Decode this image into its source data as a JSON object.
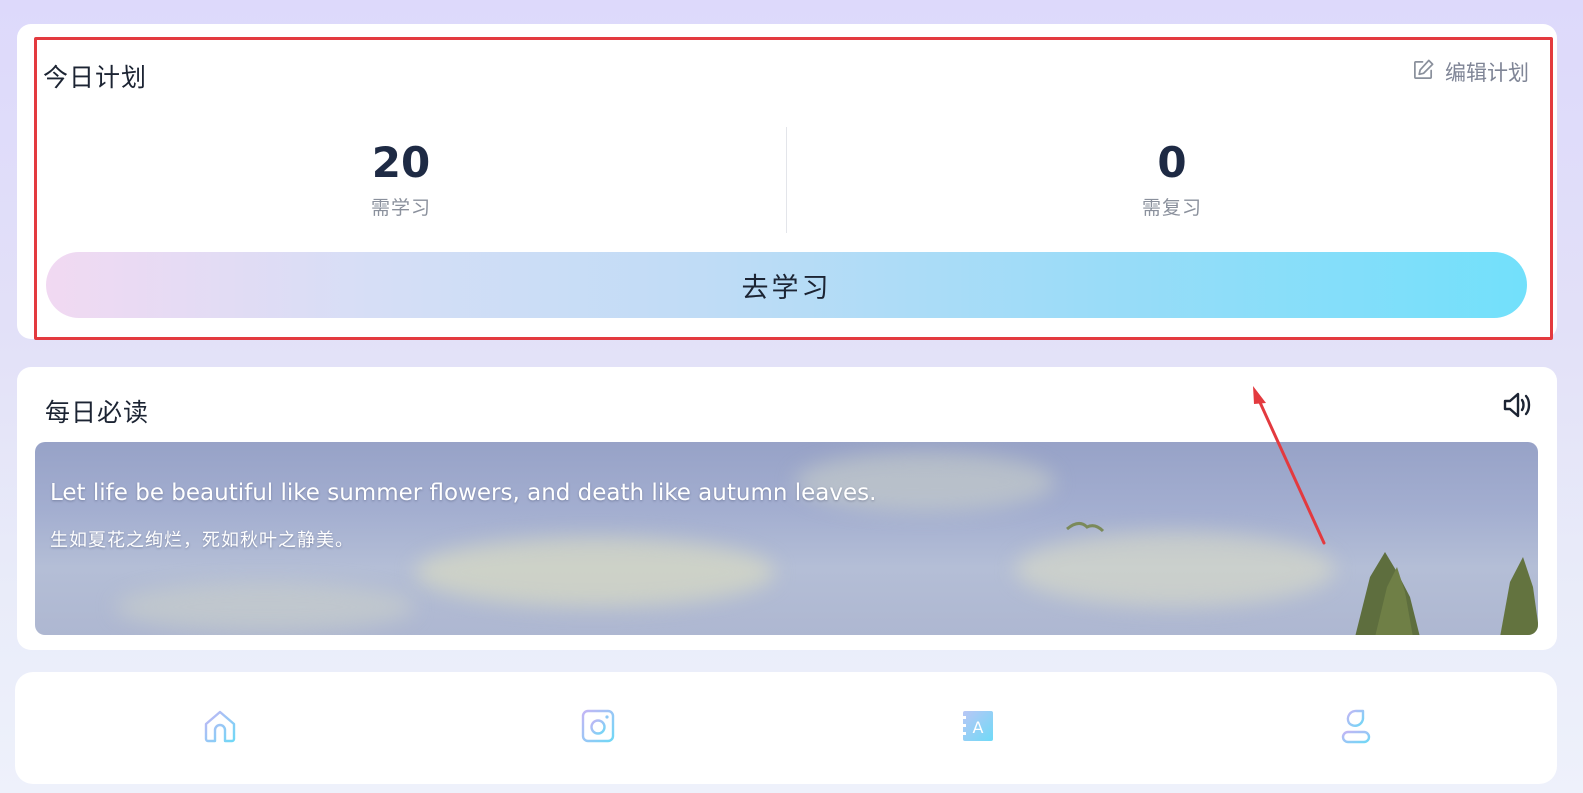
{
  "plan": {
    "title": "今日计划",
    "edit_label": "编辑计划",
    "learn_count": "20",
    "learn_label": "需学习",
    "review_count": "0",
    "review_label": "需复习",
    "go_learn_label": "去学习"
  },
  "daily_read": {
    "title": "每日必读",
    "quote_en": "Let life be beautiful like summer flowers, and death like autumn leaves.",
    "quote_zh": "生如夏花之绚烂，死如秋叶之静美。",
    "speaker_icon": "speaker-icon"
  },
  "tabbar": {
    "tabs": [
      {
        "icon": "home-icon"
      },
      {
        "icon": "camera-icon"
      },
      {
        "icon": "words-book-icon",
        "glyph": "A"
      },
      {
        "icon": "profile-icon"
      }
    ]
  },
  "colors": {
    "highlight_border": "#e33a3f",
    "annotation_arrow": "#e33a3f",
    "button_gradient_start": "#f1d9f2",
    "button_gradient_end": "#72e0fb",
    "title_text": "#1c2433"
  }
}
